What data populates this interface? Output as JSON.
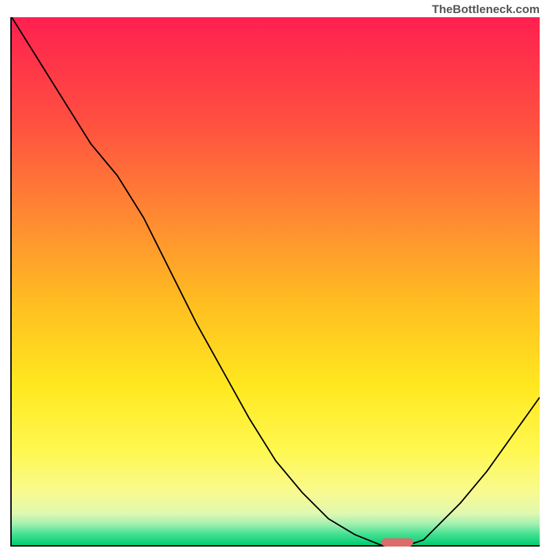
{
  "watermark": "TheBottleneck.com",
  "chart_data": {
    "type": "line",
    "x": [
      0,
      5,
      10,
      15,
      20,
      25,
      30,
      35,
      40,
      45,
      50,
      55,
      60,
      65,
      70,
      72,
      75,
      78,
      80,
      85,
      90,
      95,
      100
    ],
    "y": [
      100,
      92,
      84,
      76,
      70,
      62,
      52,
      42,
      33,
      24,
      16,
      10,
      5,
      2,
      0,
      0,
      0,
      1,
      3,
      8,
      14,
      21,
      28
    ],
    "title": "",
    "xlabel": "",
    "ylabel": "",
    "xlim": [
      0,
      100
    ],
    "ylim": [
      0,
      100
    ],
    "marker": {
      "x": 73,
      "y": 0.5,
      "width": 6,
      "height": 1.5,
      "color": "#dc6b6b"
    },
    "gradient_stops": [
      {
        "offset": 0,
        "color": "#ff2050"
      },
      {
        "offset": 20,
        "color": "#ff5040"
      },
      {
        "offset": 40,
        "color": "#ff9030"
      },
      {
        "offset": 55,
        "color": "#ffc020"
      },
      {
        "offset": 70,
        "color": "#ffe820"
      },
      {
        "offset": 82,
        "color": "#fff850"
      },
      {
        "offset": 90,
        "color": "#f8fa90"
      },
      {
        "offset": 94,
        "color": "#e0f8b0"
      },
      {
        "offset": 96,
        "color": "#a0f0b0"
      },
      {
        "offset": 98,
        "color": "#40e090"
      },
      {
        "offset": 100,
        "color": "#00cc70"
      }
    ]
  }
}
